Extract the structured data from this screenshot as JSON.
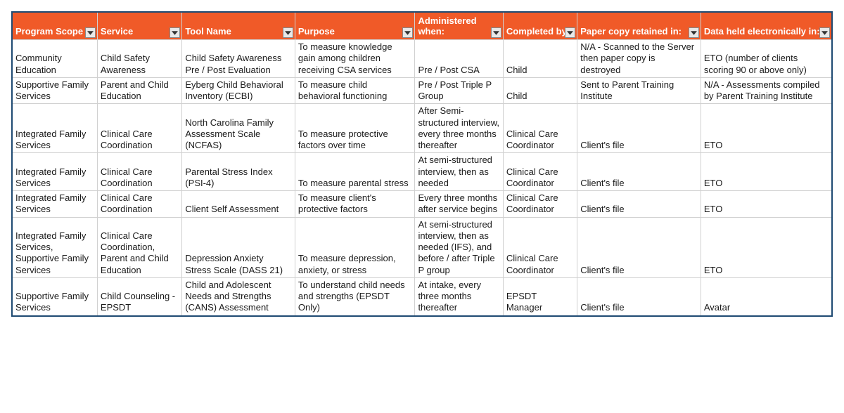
{
  "headers": [
    "Program Scope",
    "Service",
    "Tool Name",
    "Purpose",
    "Administered when:",
    "Completed by:",
    "Paper copy retained in:",
    "Data held electronically in:"
  ],
  "rows": [
    {
      "program_scope": "Community Education",
      "service": "Child Safety Awareness",
      "tool_name": "Child Safety Awareness Pre / Post Evaluation",
      "purpose": "To measure knowledge gain among children receiving CSA services",
      "administered_when": "Pre / Post CSA",
      "completed_by": "Child",
      "paper_copy": "N/A - Scanned to the Server then paper copy is destroyed",
      "data_held": "ETO (number of clients scoring 90 or above only)"
    },
    {
      "program_scope": "Supportive Family Services",
      "service": "Parent and Child Education",
      "tool_name": "Eyberg Child Behavioral Inventory (ECBI)",
      "purpose": "To measure child behavioral functioning",
      "administered_when": "Pre / Post Triple P Group",
      "completed_by": "Child",
      "paper_copy": "Sent to Parent Training Institute",
      "data_held": "N/A - Assessments compiled by Parent Training Institute"
    },
    {
      "program_scope": "Integrated Family Services",
      "service": "Clinical Care Coordination",
      "tool_name": "North Carolina Family Assessment Scale (NCFAS)",
      "purpose": "To measure protective factors over time",
      "administered_when": "After Semi-structured interview, every three months thereafter",
      "completed_by": "Clinical Care Coordinator",
      "paper_copy": "Client's file",
      "data_held": "ETO"
    },
    {
      "program_scope": "Integrated Family Services",
      "service": "Clinical Care Coordination",
      "tool_name": "Parental Stress Index (PSI-4)",
      "purpose": "To measure parental stress",
      "administered_when": "At semi-structured interview, then as needed",
      "completed_by": "Clinical Care Coordinator",
      "paper_copy": "Client's file",
      "data_held": "ETO"
    },
    {
      "program_scope": "Integrated Family Services",
      "service": "Clinical Care Coordination",
      "tool_name": "Client Self Assessment",
      "purpose": "To measure client's protective factors",
      "administered_when": "Every three months after service begins",
      "completed_by": "Clinical Care Coordinator",
      "paper_copy": "Client's file",
      "data_held": "ETO"
    },
    {
      "program_scope": "Integrated Family Services, Supportive Family Services",
      "service": "Clinical Care Coordination, Parent and Child Education",
      "tool_name": "Depression Anxiety Stress Scale (DASS 21)",
      "purpose": "To measure depression, anxiety, or stress",
      "administered_when": "At semi-structured interview, then as needed (IFS), and before / after Triple P group",
      "completed_by": "Clinical Care Coordinator",
      "paper_copy": "Client's file",
      "data_held": "ETO"
    },
    {
      "program_scope": "Supportive Family Services",
      "service": "Child Counseling - EPSDT",
      "tool_name": "Child and Adolescent Needs and Strengths (CANS) Assessment",
      "purpose": "To understand child needs and strengths (EPSDT Only)",
      "administered_when": "At intake, every three months thereafter",
      "completed_by": "EPSDT Manager",
      "paper_copy": "Client's file",
      "data_held": "Avatar"
    }
  ]
}
